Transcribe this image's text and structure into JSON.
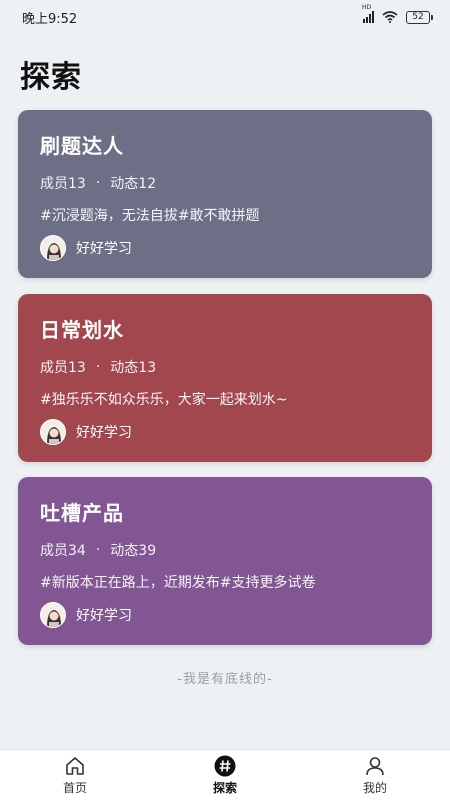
{
  "status_bar": {
    "time": "晚上9:52",
    "network_label": "HD",
    "battery": "52"
  },
  "page": {
    "title": "探索"
  },
  "groups": [
    {
      "title": "刷题达人",
      "members_label": "成员13",
      "posts_label": "动态12",
      "tags": "#沉浸题海，无法自拔#敢不敢拼题",
      "owner": "好好学习",
      "color": "#6c6f85"
    },
    {
      "title": "日常划水",
      "members_label": "成员13",
      "posts_label": "动态13",
      "tags": "#独乐乐不如众乐乐，大家一起来划水~",
      "owner": "好好学习",
      "color": "#a2474d"
    },
    {
      "title": "吐槽产品",
      "members_label": "成员34",
      "posts_label": "动态39",
      "tags": "#新版本正在路上，近期发布#支持更多试卷",
      "owner": "好好学习",
      "color": "#825593"
    }
  ],
  "stats_separator": "·",
  "footer_note": "-我是有底线的-",
  "tab_bar": {
    "tabs": [
      {
        "label": "首页",
        "icon": "home-icon"
      },
      {
        "label": "探索",
        "icon": "hashtag-icon",
        "active": true
      },
      {
        "label": "我的",
        "icon": "person-icon"
      }
    ]
  }
}
